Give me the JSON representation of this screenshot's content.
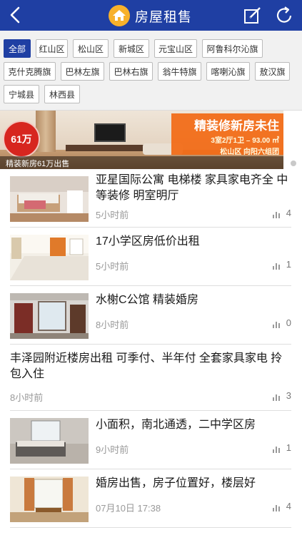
{
  "header": {
    "title": "房屋租售"
  },
  "districts": [
    "全部",
    "红山区",
    "松山区",
    "新城区",
    "元宝山区",
    "阿鲁科尔沁旗",
    "克什克腾旗",
    "巴林左旗",
    "巴林右旗",
    "翁牛特旗",
    "喀喇沁旗",
    "敖汉旗",
    "宁城县",
    "林西县"
  ],
  "banner": {
    "price": "61万",
    "promo_title": "精装修新房未住",
    "promo_line1": "3室2厅1卫 – 93.00 ㎡",
    "promo_line2": "松山区 向阳六组团",
    "caption": "精装新房61万出售"
  },
  "listings": [
    {
      "title": "亚星国际公寓 电梯楼 家具家电齐全 中等装修 明室明厅",
      "time": "5小时前",
      "views": "4"
    },
    {
      "title": "17小学区房低价出租",
      "time": "5小时前",
      "views": "1"
    },
    {
      "title": "水榭C公馆 精装婚房",
      "time": "8小时前",
      "views": "0"
    },
    {
      "title": "丰泽园附近楼房出租 可季付、半年付 全套家具家电 拎包入住",
      "time": "8小时前",
      "views": "3"
    },
    {
      "title": "小面积，南北通透，二中学区房",
      "time": "9小时前",
      "views": "1"
    },
    {
      "title": "婚房出售，房子位置好，楼层好",
      "time": "07月10日 17:38",
      "views": "4"
    }
  ],
  "colors": {
    "header": "#1f3fa3",
    "banner_promo": "#f26b16",
    "price_badge": "#d7261f"
  }
}
